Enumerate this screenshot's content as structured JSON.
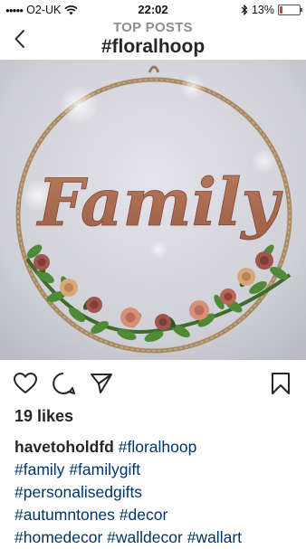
{
  "status_bar": {
    "carrier": "O2-UK",
    "time": "22:02",
    "battery_percent": "13%",
    "battery_level": 0.13,
    "icons": [
      "signal-dots-icon",
      "wifi-icon",
      "bluetooth-icon",
      "battery-icon"
    ]
  },
  "header": {
    "subtitle": "TOP POSTS",
    "title": "#floralhoop"
  },
  "photo": {
    "word": "Family"
  },
  "actions": {
    "icons": [
      "heart-icon",
      "comment-icon",
      "share-icon",
      "bookmark-icon"
    ]
  },
  "post": {
    "likes": "19 likes",
    "username": "havetoholdfd",
    "hashtags": [
      "#floralhoop",
      "#family",
      "#familygift",
      "#personalisedgifts",
      "#autumntones",
      "#decor",
      "#homedecor",
      "#walldecor",
      "#wallart"
    ]
  },
  "colors": {
    "hashtag": "#003569",
    "header_sub": "#8e8e8e",
    "text": "#262626",
    "battery_low": "#e53935"
  }
}
